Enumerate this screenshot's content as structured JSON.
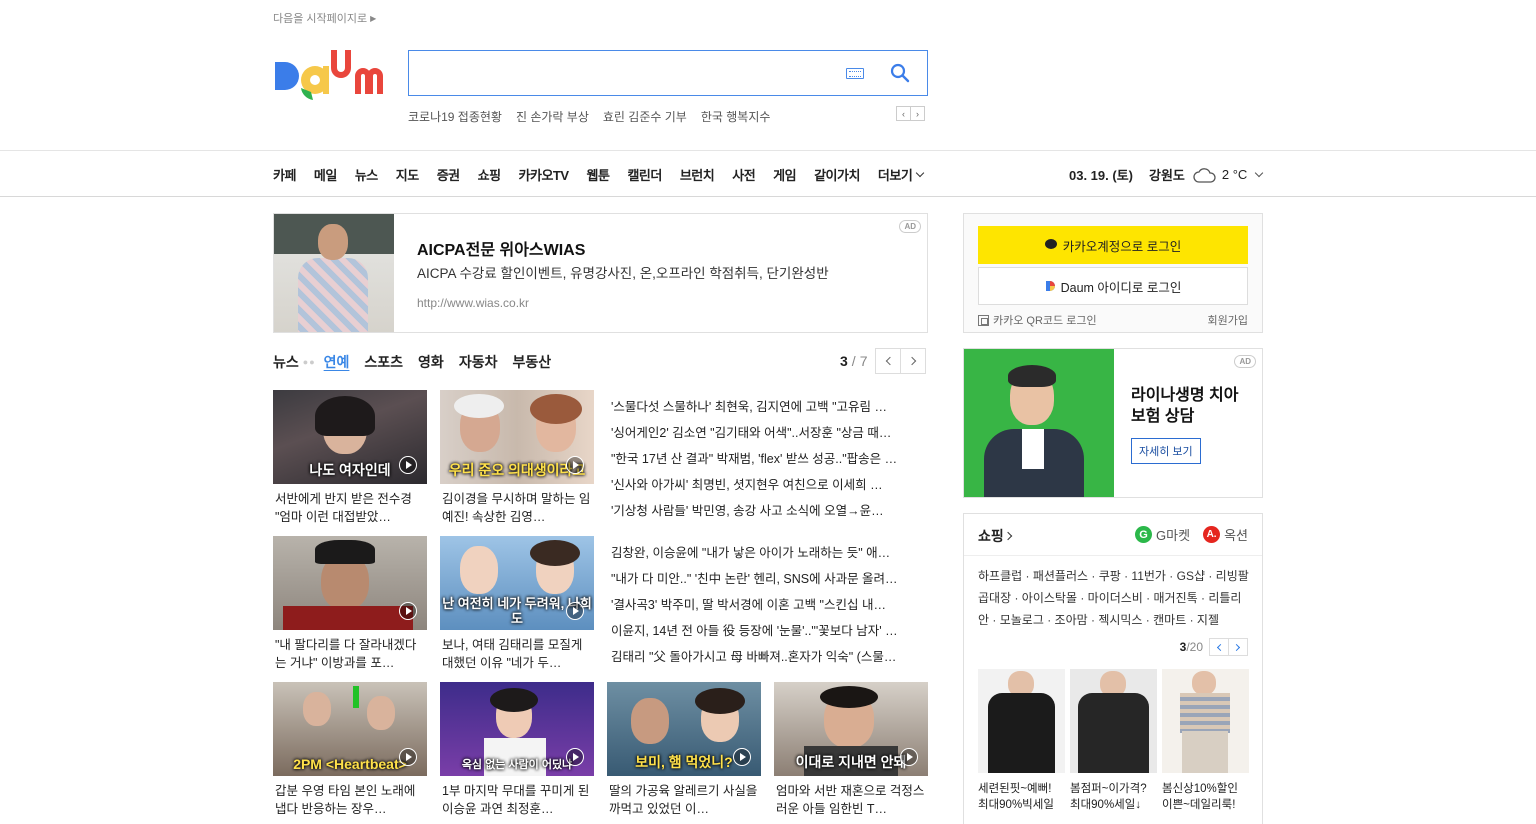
{
  "header": {
    "set_start": "다음을 시작페이지로",
    "keywords": [
      "코로나19 접종현황",
      "진 손가락 부상",
      "효린 김준수 기부",
      "한국 행복지수"
    ]
  },
  "nav": {
    "items": [
      "카페",
      "메일",
      "뉴스",
      "지도",
      "증권",
      "쇼핑",
      "카카오TV",
      "웹툰",
      "캘린더",
      "브런치",
      "사전",
      "게임",
      "같이가치"
    ],
    "more": "더보기"
  },
  "weather": {
    "date": "03. 19. (토)",
    "region": "강원도",
    "temp": "2 °C",
    "icon": "cloud-icon"
  },
  "ad_banner": {
    "badge": "AD",
    "title": "AICPA전문 위아스WIAS",
    "desc": "AICPA 수강료 할인이벤트, 유명강사진, 온,오프라인 학점취득, 단기완성반",
    "url": "http://www.wias.co.kr"
  },
  "news": {
    "tabs": [
      "뉴스",
      "연예",
      "스포츠",
      "영화",
      "자동차",
      "부동산"
    ],
    "active_tab": "연예",
    "page": "3",
    "total": "7",
    "cards_row1": [
      {
        "caption": "나도 여자인데",
        "text": "서반에게 반지 받은 전수경 \"엄마 이런 대접받았…"
      },
      {
        "caption": "우리 준오 의대생이라고",
        "text": "김이경을 무시하며 말하는 임예진! 속상한 김영…"
      }
    ],
    "list1": [
      "'스물다섯 스물하나' 최현욱, 김지연에 고백 \"고유림 …",
      "'싱어게인2' 김소연 \"김기태와 어색\"..서장훈 \"상금 때…",
      "\"한국 17년 산 결과\" 박재범, 'flex' 받쓰 성공..\"팝송은 …",
      "'신사와 아가씨' 최명빈, 셧지현우 여친으로 이세희 …",
      "'기상청 사람들' 박민영, 송강 사고 소식에 오열→윤…"
    ],
    "cards_row2": [
      {
        "caption": "",
        "text": "\"내 팔다리를 다 잘라내겠다는 거냐\" 이방과를 포…"
      },
      {
        "caption": "난 여전히 네가 두려워, 나희도",
        "text": "보나, 여태 김태리를 모질게 대했던 이유 \"네가 두…"
      }
    ],
    "list2": [
      "김창완, 이승윤에 \"내가 낳은 아이가 노래하는 듯\" 애…",
      "\"내가 다 미안..\" '친中 논란' 헨리, SNS에 사과문 올려…",
      "'결사곡3' 박주미, 딸 박서경에 이혼 고백 \"스킨십 내…",
      "이윤지, 14년 전 아들 役 등장에 '눈물'..\"'꽃보다 남자' …",
      "김태리 \"父 돌아가시고 母 바빠져..혼자가 익숙\" (스물…"
    ],
    "cards_row3": [
      {
        "caption": "2PM <Heartbeat>",
        "text": "갑분 우영 타임 본인 노래에 냅다 반응하는 장우…"
      },
      {
        "caption": "옥심 없는 사람이 어딨냐",
        "text": "1부 마지막 무대를 꾸미게 된 이승윤 과연 최정훈…"
      },
      {
        "caption": "보미, 햄 먹었니?",
        "text": "딸의 가공육 알레르기 사실을 까먹고 있었던 이…"
      },
      {
        "caption": "이대로 지내면 안돼",
        "text": "엄마와 서반 재혼으로 걱정스러운 아들 임한빈 T…"
      }
    ]
  },
  "login": {
    "kakao": "카카오계정으로 로그인",
    "daum": "Daum 아이디로 로그인",
    "qr": "카카오 QR코드 로그인",
    "signup": "회원가입"
  },
  "side_ad": {
    "badge": "AD",
    "title": "라이나생명 치아보험 상담",
    "button": "자세히 보기"
  },
  "shopping": {
    "title": "쇼핑",
    "gmarket": "G마켓",
    "auction": "옥션",
    "links": "하프클럽 · 패션플러스 · 쿠팡 · 11번가 · GS샵 · 리빙팔곱대장 · 아이스탁몰 · 마이더스비 · 매거진톡 · 리틀리안 · 모놀로그 · 조아맘 · 젝시믹스 · 캔마트 · 지젤",
    "page": "3",
    "total": "/20",
    "items": [
      {
        "line1": "세련된핏~예뻐!",
        "line2": "최대90%빅세일"
      },
      {
        "line1": "봄점퍼~이가격?",
        "line2": "최대90%세일↓"
      },
      {
        "line1": "봄신상10%할인",
        "line2": "이쁜~데일리룩!"
      }
    ]
  }
}
